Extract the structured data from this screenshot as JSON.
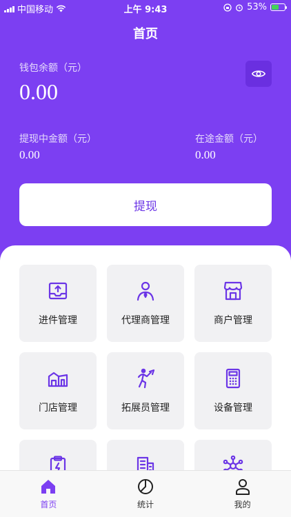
{
  "status_bar": {
    "carrier": "中国移动",
    "time": "上午 9:43",
    "battery": "53%"
  },
  "header": {
    "title": "首页"
  },
  "wallet": {
    "balance_label": "钱包余额（元）",
    "balance_value": "0.00",
    "withdrawing_label": "提现中金额（元）",
    "withdrawing_value": "0.00",
    "in_transit_label": "在途金额（元）",
    "in_transit_value": "0.00",
    "withdraw_button": "提现"
  },
  "menu": [
    {
      "label": "进件管理",
      "icon": "upload-tray-icon"
    },
    {
      "label": "代理商管理",
      "icon": "agent-person-icon"
    },
    {
      "label": "商户管理",
      "icon": "storefront-icon"
    },
    {
      "label": "门店管理",
      "icon": "store-building-icon"
    },
    {
      "label": "拓展员管理",
      "icon": "expander-figure-icon"
    },
    {
      "label": "设备管理",
      "icon": "calculator-device-icon"
    },
    {
      "label": "",
      "icon": "clipboard-icon"
    },
    {
      "label": "",
      "icon": "buildings-icon"
    },
    {
      "label": "",
      "icon": "network-icon"
    }
  ],
  "tabbar": [
    {
      "label": "首页",
      "icon": "home-icon",
      "active": true
    },
    {
      "label": "统计",
      "icon": "stats-icon",
      "active": false
    },
    {
      "label": "我的",
      "icon": "profile-icon",
      "active": false
    }
  ],
  "colors": {
    "accent": "#7c3ff2",
    "accent_dark": "#6a2fe0",
    "tile_bg": "#f1f1f3"
  }
}
